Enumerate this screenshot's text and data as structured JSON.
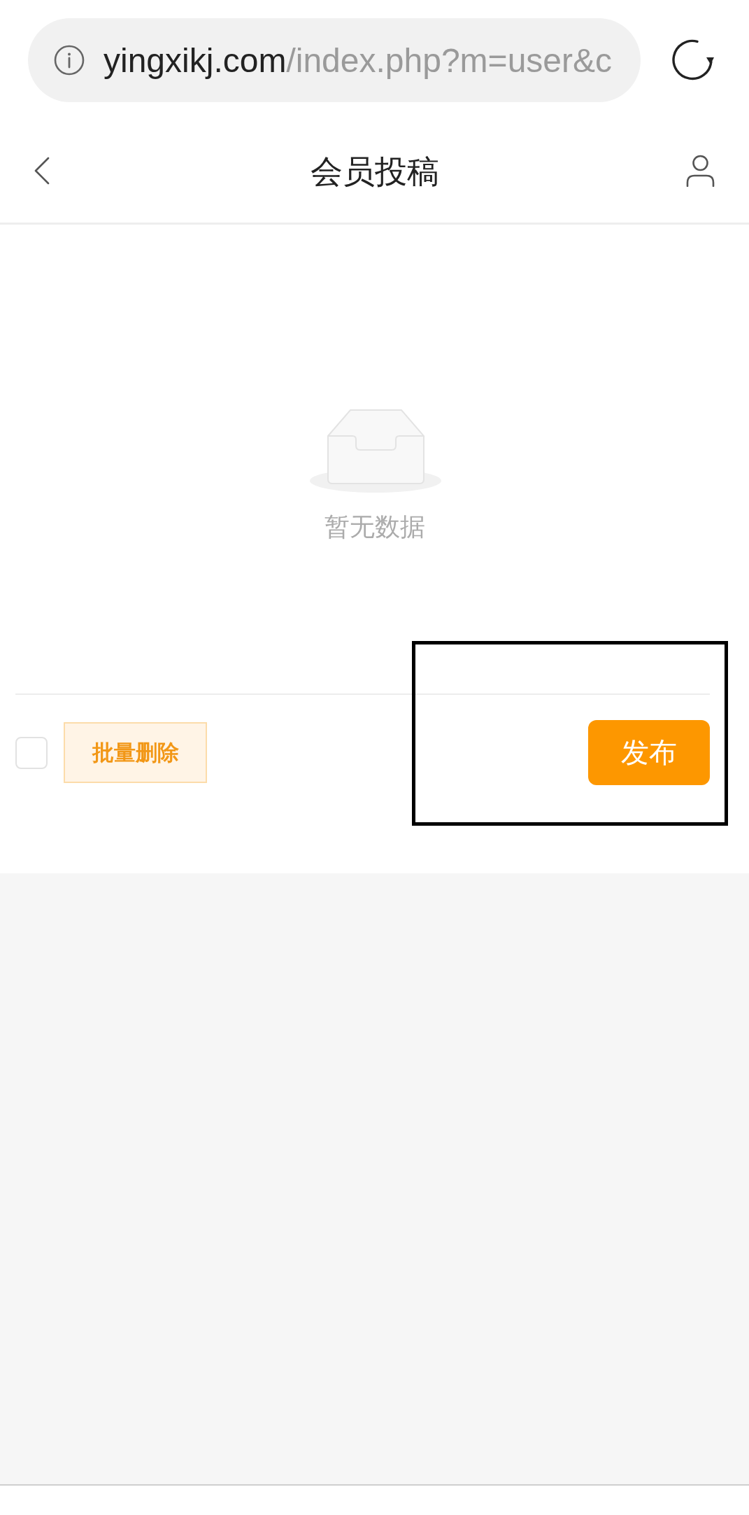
{
  "browser": {
    "url_host": "yingxikj.com",
    "url_path": "/index.php?m=user&c"
  },
  "header": {
    "title": "会员投稿"
  },
  "empty_state": {
    "message": "暂无数据"
  },
  "toolbar": {
    "select_all": {
      "checked": false
    },
    "delete_button": "批量删除",
    "publish_button": "发布",
    "publish_highlighted": true
  }
}
